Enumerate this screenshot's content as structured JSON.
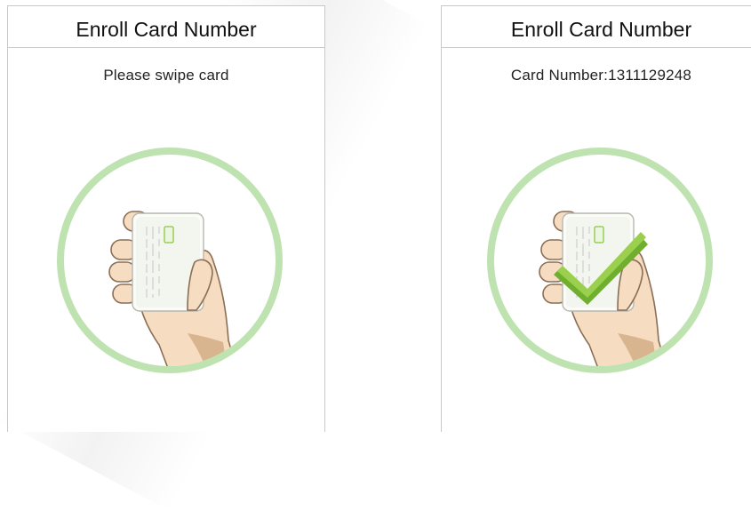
{
  "left_panel": {
    "title": "Enroll Card Number",
    "prompt": "Please swipe card",
    "illustration_icon": "hand-holding-card-icon"
  },
  "right_panel": {
    "title": "Enroll Card Number",
    "prompt": "Card Number:1311129248",
    "illustration_icon": "hand-holding-card-checkmark-icon"
  },
  "colors": {
    "ring": "#bfe3b0",
    "skin": "#f6dcc0",
    "skin_outline": "#8a6e56",
    "check": "#8bc83e"
  }
}
